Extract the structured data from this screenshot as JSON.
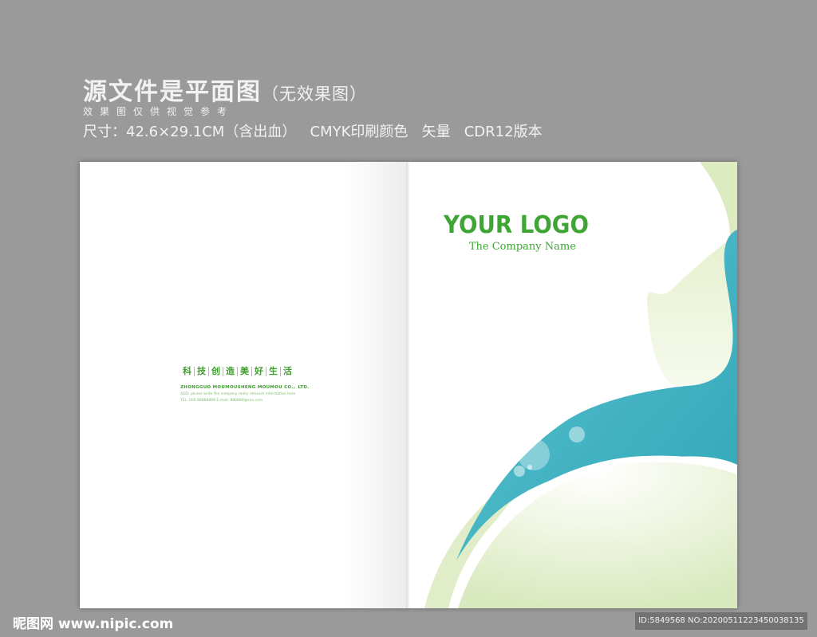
{
  "header": {
    "title": "源文件是平面图",
    "title_sub": "（无效果图）",
    "note": "效果图仅供视觉参考",
    "spec": "尺寸：42.6×29.1CM（含出血）   CMYK印刷颜色   矢量   CDR12版本"
  },
  "left_page": {
    "slogan_chars": [
      "科",
      "技",
      "创",
      "造",
      "美",
      "好",
      "生",
      "活"
    ],
    "company": "ZHONGGUO MOUMOUSHENG MOUMOU CO.，LTD.",
    "address": "ADD: please write the company really relevant information here",
    "contact": "TEL: 000 88888888     E-mail: 888888@xxx.com"
  },
  "right_page": {
    "logo": "YOUR LOGO",
    "company_name": "The Company Name"
  },
  "watermark": {
    "site": "昵图网 www.nipic.com",
    "id": "ID:5849568 NO:20200511223450038135"
  },
  "colors": {
    "brand_green": "#3fa535",
    "teal": "#3ab2c2",
    "light_green": "#d8e8b8",
    "background": "#9a9a9a"
  }
}
